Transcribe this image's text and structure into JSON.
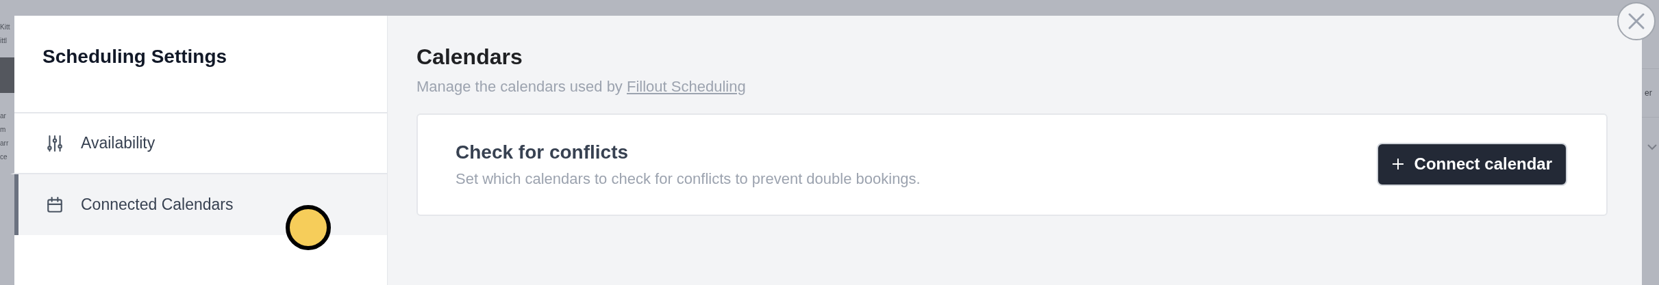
{
  "background": {
    "left_fragments": [
      "Kitt",
      "ittl",
      "ar",
      "m",
      "arr",
      "ce"
    ],
    "right_fragments": [
      "er"
    ]
  },
  "sidebar": {
    "title": "Scheduling Settings",
    "items": [
      {
        "label": "Availability",
        "kind": "sliders",
        "selected": false
      },
      {
        "label": "Connected Calendars",
        "kind": "calendar",
        "selected": true
      }
    ]
  },
  "page": {
    "title": "Calendars",
    "subtitle": "Manage the calendars used by ",
    "subtitle_link": "Fillout Scheduling"
  },
  "card": {
    "title": "Check for conflicts",
    "description": "Set which calendars to check for conflicts to prevent double bookings.",
    "button": "Connect calendar"
  }
}
